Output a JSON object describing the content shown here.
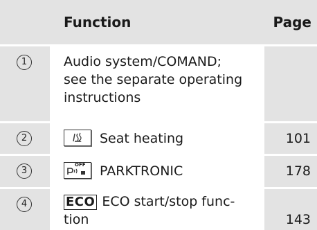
{
  "header": {
    "function": "Function",
    "page": "Page"
  },
  "rows": [
    {
      "num": "1",
      "lines": [
        "Audio system/COMAND;",
        "see the separate operating",
        "instructions"
      ],
      "page": ""
    },
    {
      "num": "2",
      "icon": "seat-heating-icon",
      "text": "Seat heating",
      "page": "101"
    },
    {
      "num": "3",
      "icon": "parktronic-off-icon",
      "icon_label": "OFF",
      "text": "PARKTRONIC",
      "page": "178"
    },
    {
      "num": "4",
      "eco": "ECO",
      "lines": [
        "ECO start/stop func-",
        "tion"
      ],
      "page": "143"
    }
  ]
}
